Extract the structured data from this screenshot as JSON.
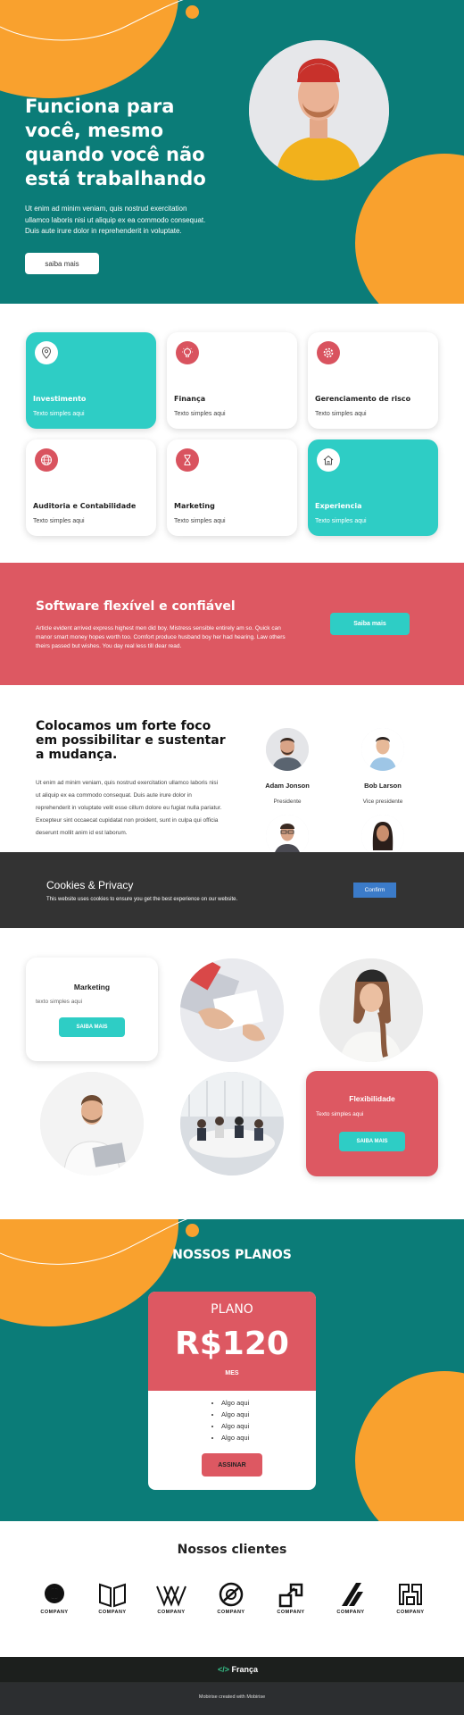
{
  "hero": {
    "title": "Funciona para você, mesmo quando você não está trabalhando",
    "description": "Ut enim ad minim veniam, quis nostrud exercitation ullamco laboris nisi ut aliquip ex ea commodo consequat. Duis aute irure dolor in reprehenderit in voluptate.",
    "button": "saiba mais"
  },
  "services": [
    {
      "title": "Investimento",
      "subtitle": "Texto simples aqui",
      "icon": "location-pin-icon",
      "highlight": true
    },
    {
      "title": "Finança",
      "subtitle": "Texto simples aqui",
      "icon": "lightbulb-icon",
      "highlight": false
    },
    {
      "title": "Gerenciamento de risco",
      "subtitle": "Texto simples aqui",
      "icon": "gear-icon",
      "highlight": false
    },
    {
      "title": "Auditoria e Contabilidade",
      "subtitle": "Texto simples aqui",
      "icon": "globe-icon",
      "highlight": false
    },
    {
      "title": "Marketing",
      "subtitle": "Texto simples aqui",
      "icon": "hourglass-icon",
      "highlight": false
    },
    {
      "title": "Experiencia",
      "subtitle": "Texto simples aqui",
      "icon": "house-icon",
      "highlight": true
    }
  ],
  "software": {
    "title": "Software flexível e confiável",
    "description": "Article evident arrived express highest men did boy. Mistress sensible entirely am so. Quick can manor smart money hopes worth too. Comfort produce husband boy her had hearing. Law others theirs passed but wishes. You day real less till dear read.",
    "button": "Saiba mais"
  },
  "team": {
    "title": "Colocamos um forte foco em possibilitar e sustentar a mudança.",
    "description": "Ut enim ad minim veniam, quis nostrud exercitation ullamco laboris nisi ut aliquip ex ea commodo consequat. Duis aute irure dolor in reprehenderit in voluptate velit esse cillum dolore eu fugiat nulla pariatur. Excepteur sint occaecat cupidatat non proident, sunt in culpa qui officia deserunt mollit anim id est laborum.",
    "members": [
      {
        "name": "Adam Jonson",
        "role": "Presidente"
      },
      {
        "name": "Bob Larson",
        "role": "Vice presidente"
      }
    ]
  },
  "cookies": {
    "title": "Cookies & Privacy",
    "text": "This website uses cookies to ensure you get the best experience on our website.",
    "button": "Confirm"
  },
  "gallery": {
    "card1": {
      "title": "Marketing",
      "subtitle": "texto simples aqui",
      "button": "SAIBA MAIS"
    },
    "card2": {
      "title": "Flexibilidade",
      "subtitle": "Texto simples aqui",
      "button": "SAIBA MAIS"
    }
  },
  "plans": {
    "title": "NOSSOS PLANOS",
    "plan_name": "PLANO",
    "price": "R$120",
    "period": "MES",
    "features": [
      "Algo aqui",
      "Algo aqui",
      "Algo aqui",
      "Algo aqui"
    ],
    "button": "ASSINAR"
  },
  "clients": {
    "title": "Nossos clientes",
    "logos": [
      "COMPANY",
      "COMPANY",
      "COMPANY",
      "COMPANY",
      "COMPANY",
      "COMPANY",
      "COMPANY"
    ]
  },
  "footer": {
    "brand_prefix": "</>",
    "brand": "França",
    "credit": "Mobirise created with Mobirise"
  },
  "colors": {
    "teal_dark": "#0b7c78",
    "teal_light": "#2ecdc5",
    "orange": "#f9a12e",
    "red": "#dd5862"
  }
}
